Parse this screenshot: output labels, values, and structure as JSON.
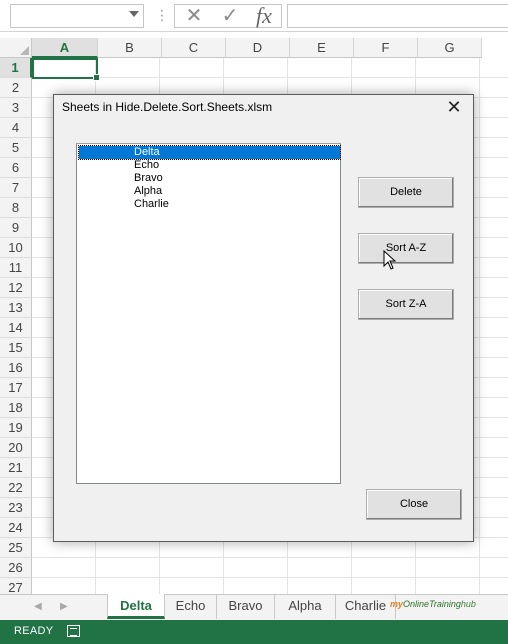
{
  "formula_bar": {
    "name_box_value": "",
    "cancel_glyph": "✕",
    "enter_glyph": "✓",
    "fx_label": "fx",
    "formula_value": ""
  },
  "grid": {
    "columns": [
      "A",
      "B",
      "C",
      "D",
      "E",
      "F",
      "G"
    ],
    "rows": [
      "1",
      "2",
      "3",
      "4",
      "5",
      "6",
      "7",
      "8",
      "9",
      "10",
      "11",
      "12",
      "13",
      "14",
      "15",
      "16",
      "17",
      "18",
      "19",
      "20",
      "21",
      "22",
      "23",
      "24",
      "25",
      "26",
      "27"
    ],
    "active_cell": "A1"
  },
  "dialog": {
    "title": "Sheets in Hide.Delete.Sort.Sheets.xlsm",
    "close_glyph": "✕",
    "sheet_list": [
      "Delta",
      "Echo",
      "Bravo",
      "Alpha",
      "Charlie"
    ],
    "selected_sheet": "Delta",
    "buttons": {
      "delete": "Delete",
      "sort_az": "Sort A-Z",
      "sort_za": "Sort Z-A",
      "close": "Close"
    }
  },
  "sheet_tabs": {
    "tabs": [
      "Delta",
      "Echo",
      "Bravo",
      "Alpha",
      "Charlie"
    ],
    "active": "Delta",
    "brand": {
      "part1": "my",
      "part2": "OnlineTraining",
      "part3": "hub"
    }
  },
  "status_bar": {
    "ready": "READY"
  },
  "colors": {
    "excel_green": "#217346",
    "selection_blue": "#0078d7"
  }
}
